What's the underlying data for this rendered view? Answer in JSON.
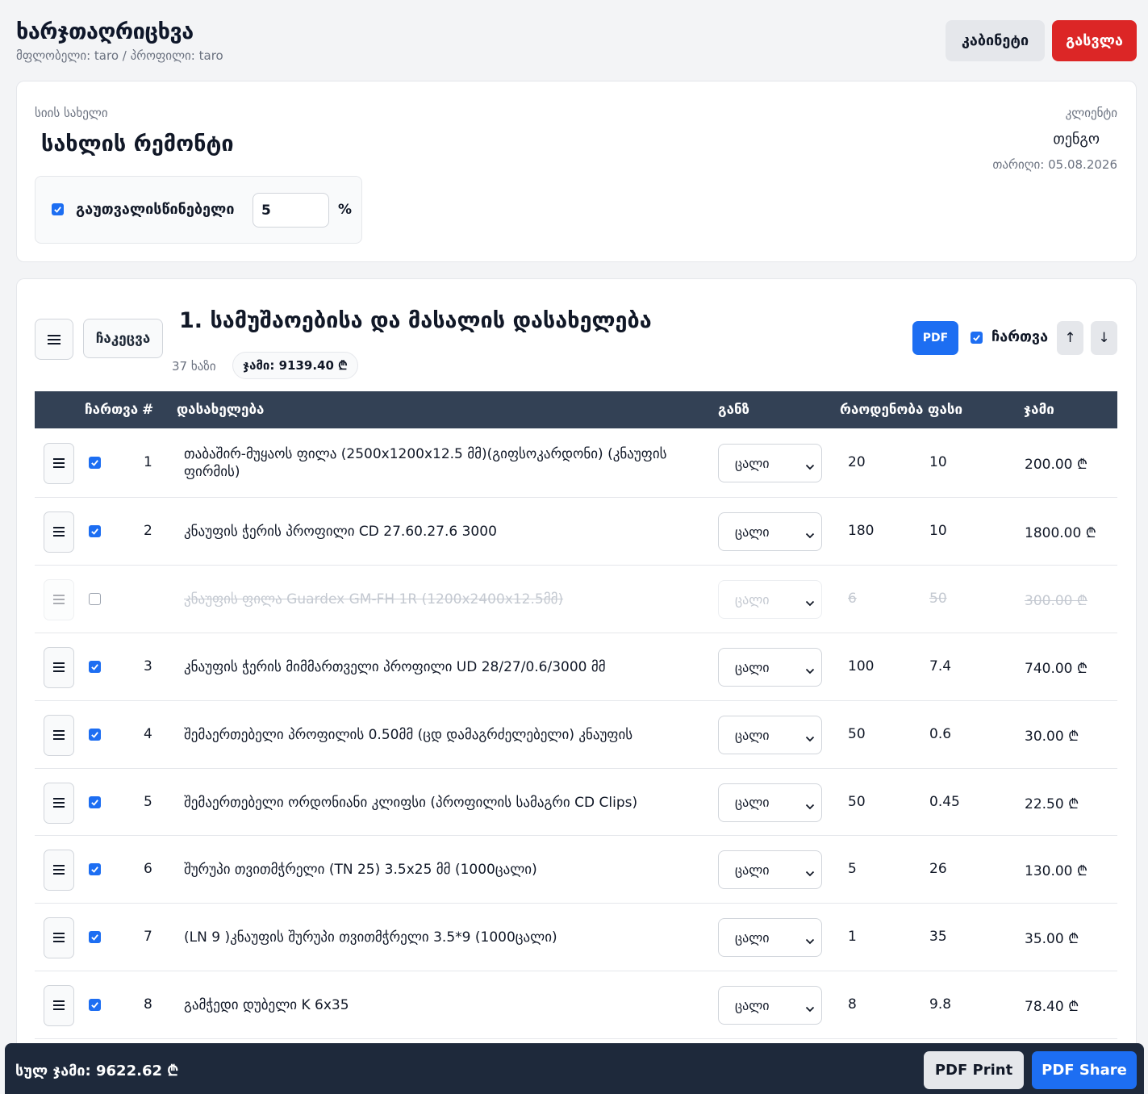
{
  "header": {
    "title": "ხარჯთაღრიცხვა",
    "subtitle": "მფლობელი: taro / პროფილი: taro",
    "cabinet_label": "კაბინეტი",
    "logout_label": "გასვლა"
  },
  "info": {
    "list_name_label": "სიის სახელი",
    "list_name": "სახლის რემონტი",
    "client_label": "კლიენტი",
    "client_name": "თენგო",
    "date": "თარიღი: 05.08.2026",
    "unforeseen_label": "გაუთვალისწინებელი",
    "unforeseen_checked": true,
    "unforeseen_value": "5",
    "unforeseen_unit": "%"
  },
  "section": {
    "collapse_label": "ჩაკეცვა",
    "title": "1. სამუშაოებისა და მასალის დასახელება",
    "count": "37 ხაზი",
    "sum": "ჯამი: 9139.40 ₾",
    "pdf_label": "PDF",
    "enable_label": "ჩართვა",
    "enabled": true,
    "up_label": "↑",
    "down_label": "↓"
  },
  "table": {
    "columns": {
      "enable": "ჩართვა",
      "num": "#",
      "desc": "დასახელება",
      "unit": "განზ",
      "qty": "რაოდენობა",
      "price": "ფასი",
      "total": "ჯამი"
    },
    "rows": [
      {
        "enabled": true,
        "num": "1",
        "desc": "თაბაშირ-მუყაოს ფილა (2500x1200x12.5 მმ)(გიფსოკარდონი) (კნაუფის ფირმის)",
        "unit": "ცალი",
        "qty": "20",
        "price": "10",
        "total": "200.00 ₾"
      },
      {
        "enabled": true,
        "num": "2",
        "desc": "კნაუფის ჭერის პროფილი CD 27.60.27.6 3000",
        "unit": "ცალი",
        "qty": "180",
        "price": "10",
        "total": "1800.00 ₾"
      },
      {
        "enabled": false,
        "num": "",
        "desc": "კნაუფის ფილა Guardex GM-FH 1R (1200x2400x12.5მმ)",
        "unit": "ცალი",
        "qty": "6",
        "price": "50",
        "total": "300.00 ₾"
      },
      {
        "enabled": true,
        "num": "3",
        "desc": "კნაუფის ჭერის მიმმართველი პროფილი UD 28/27/0.6/3000 მმ",
        "unit": "ცალი",
        "qty": "100",
        "price": "7.4",
        "total": "740.00 ₾"
      },
      {
        "enabled": true,
        "num": "4",
        "desc": "შემაერთებელი პროფილის 0.50მმ (ცდ დამაგრძელებელი) კნაუფის",
        "unit": "ცალი",
        "qty": "50",
        "price": "0.6",
        "total": "30.00 ₾"
      },
      {
        "enabled": true,
        "num": "5",
        "desc": "შემაერთებელი ორდონიანი კლიფსი (პროფილის სამაგრი CD Clips)",
        "unit": "ცალი",
        "qty": "50",
        "price": "0.45",
        "total": "22.50 ₾"
      },
      {
        "enabled": true,
        "num": "6",
        "desc": "შურუპი თვითმჭრელი (TN 25) 3.5x25 მმ (1000ცალი)",
        "unit": "ცალი",
        "qty": "5",
        "price": "26",
        "total": "130.00 ₾"
      },
      {
        "enabled": true,
        "num": "7",
        "desc": "(LN 9 )კნაუფის შურუპი თვითმჭრელი 3.5*9 (1000ცალი)",
        "unit": "ცალი",
        "qty": "1",
        "price": "35",
        "total": "35.00 ₾"
      },
      {
        "enabled": true,
        "num": "8",
        "desc": "გამჭედი დუბელი K 6x35",
        "unit": "ცალი",
        "qty": "8",
        "price": "9.8",
        "total": "78.40 ₾"
      }
    ]
  },
  "footer": {
    "grand_total": "სულ ჯამი: 9622.62 ₾",
    "pdf_print_label": "PDF Print",
    "pdf_share_label": "PDF Share"
  },
  "colors": {
    "accent": "#1d6ef2",
    "danger": "#dc2626",
    "table_header": "#334155",
    "footer": "#1e293b"
  }
}
